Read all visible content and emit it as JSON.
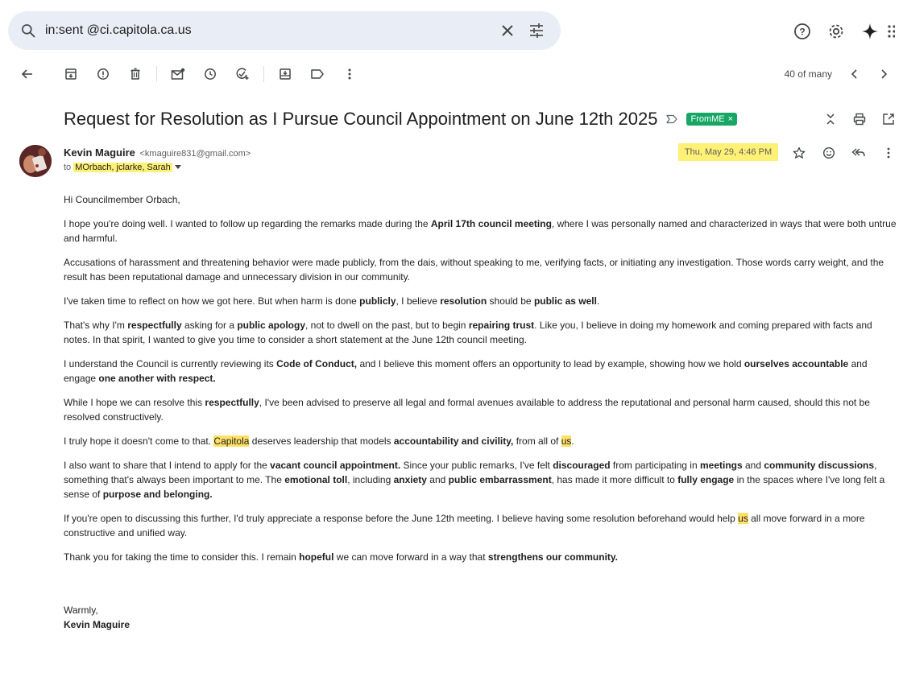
{
  "search": {
    "query": "in:sent @ci.capitola.ca.us",
    "icon": "search-icon",
    "clear_icon": "close-icon",
    "filter_icon": "tune-icon"
  },
  "topbar": {
    "icons": [
      "help-icon",
      "settings-icon",
      "gemini-sparkle-icon",
      "apps-grid-icon"
    ]
  },
  "toolbar": {
    "icons": [
      "back-arrow-icon",
      "archive-icon",
      "report-spam-icon",
      "delete-icon",
      "mark-unread-icon",
      "snooze-icon",
      "add-task-icon",
      "move-to-icon",
      "label-icon",
      "more-vert-icon"
    ]
  },
  "pager": {
    "count": "40 of many"
  },
  "message": {
    "subject": "Request for Resolution as I Pursue Council Appointment on June 12th 2025",
    "label": "FromME",
    "label_close": "×",
    "sender_name": "Kevin Maguire",
    "sender_email": "<kmaguire831@gmail.com>",
    "to_prefix": "to",
    "to_names": "MOrbach, jclarke, Sarah",
    "date": "Thu, May 29, 4:46 PM"
  },
  "body": {
    "greeting": "Hi Councilmember Orbach,",
    "p1": {
      "a": "I hope you're doing well. I wanted to follow up regarding the remarks made during the ",
      "b1": "April 17th council meeting",
      "c": ", where I was personally named and characterized in ways that were both untrue and harmful."
    },
    "p2": "Accusations of harassment and threatening behavior were made publicly, from the dais, without speaking to me, verifying facts, or initiating any investigation. Those words carry weight, and the result has been reputational damage and unnecessary division in our community.",
    "p3": {
      "a": "I've taken time to reflect on how we got here. But when harm is done ",
      "b1": "publicly",
      "c": ", I believe ",
      "b2": "resolution",
      "d": " should be ",
      "b3": "public as well",
      "e": "."
    },
    "p4": {
      "a": "That's why I'm ",
      "b1": "respectfully",
      "c": " asking for a ",
      "b2": "public apology",
      "d": ", not to dwell on the past, but to begin ",
      "b3": "repairing trust",
      "e": ". Like you, I believe in doing my homework and coming prepared with facts and notes. In that spirit, I wanted to give you time to consider a short statement at the June 12th council meeting."
    },
    "p5": {
      "a": "I understand the Council is currently reviewing its ",
      "b1": "Code of Conduct,",
      "c": " and I believe this moment offers an opportunity to lead by example, showing how we hold ",
      "b2": "ourselves accountable",
      "d": " and engage ",
      "b3": "one another with respect."
    },
    "p6": {
      "a": "While I hope we can resolve this ",
      "b1": "respectfully",
      "c": ", I've been advised to preserve all legal and formal avenues available to address the reputational and personal harm caused, should this not be resolved constructively."
    },
    "p7": {
      "a": "I truly hope it doesn't come to that. ",
      "h1": "Capitola",
      "c": " deserves leadership that models ",
      "b1": "accountability and civility,",
      "d": " from all of ",
      "h2": "us",
      "e": "."
    },
    "p8": {
      "a": "I also want to share that I intend to apply for the ",
      "b1": "vacant council appointment.",
      "c": " Since your public remarks, I've felt ",
      "b2": "discouraged",
      "d": " from participating in ",
      "b3": "meetings",
      "e": " and ",
      "b4": "community discussions",
      "f": ", something that's always been important to me. The ",
      "b5": "emotional toll",
      "g": ", including ",
      "b6": "anxiety",
      "h": " and ",
      "b7": "public embarrassment",
      "i": ", has made it more difficult to ",
      "b8": "fully engage",
      "j": " in the spaces where I've long felt a sense of ",
      "b9": "purpose and belonging."
    },
    "p9": {
      "a": "If you're open to discussing this further, I'd truly appreciate a response before the June 12th meeting. I believe having some resolution beforehand would help ",
      "h1": "us",
      "c": " all move forward in a more constructive and unified way."
    },
    "p10": {
      "a": "Thank you for taking the time to consider this. I remain ",
      "b1": "hopeful",
      "c": " we can move forward in a way that ",
      "b2": "strengthens our community."
    },
    "closing": "Warmly,",
    "signature": "Kevin Maguire"
  }
}
